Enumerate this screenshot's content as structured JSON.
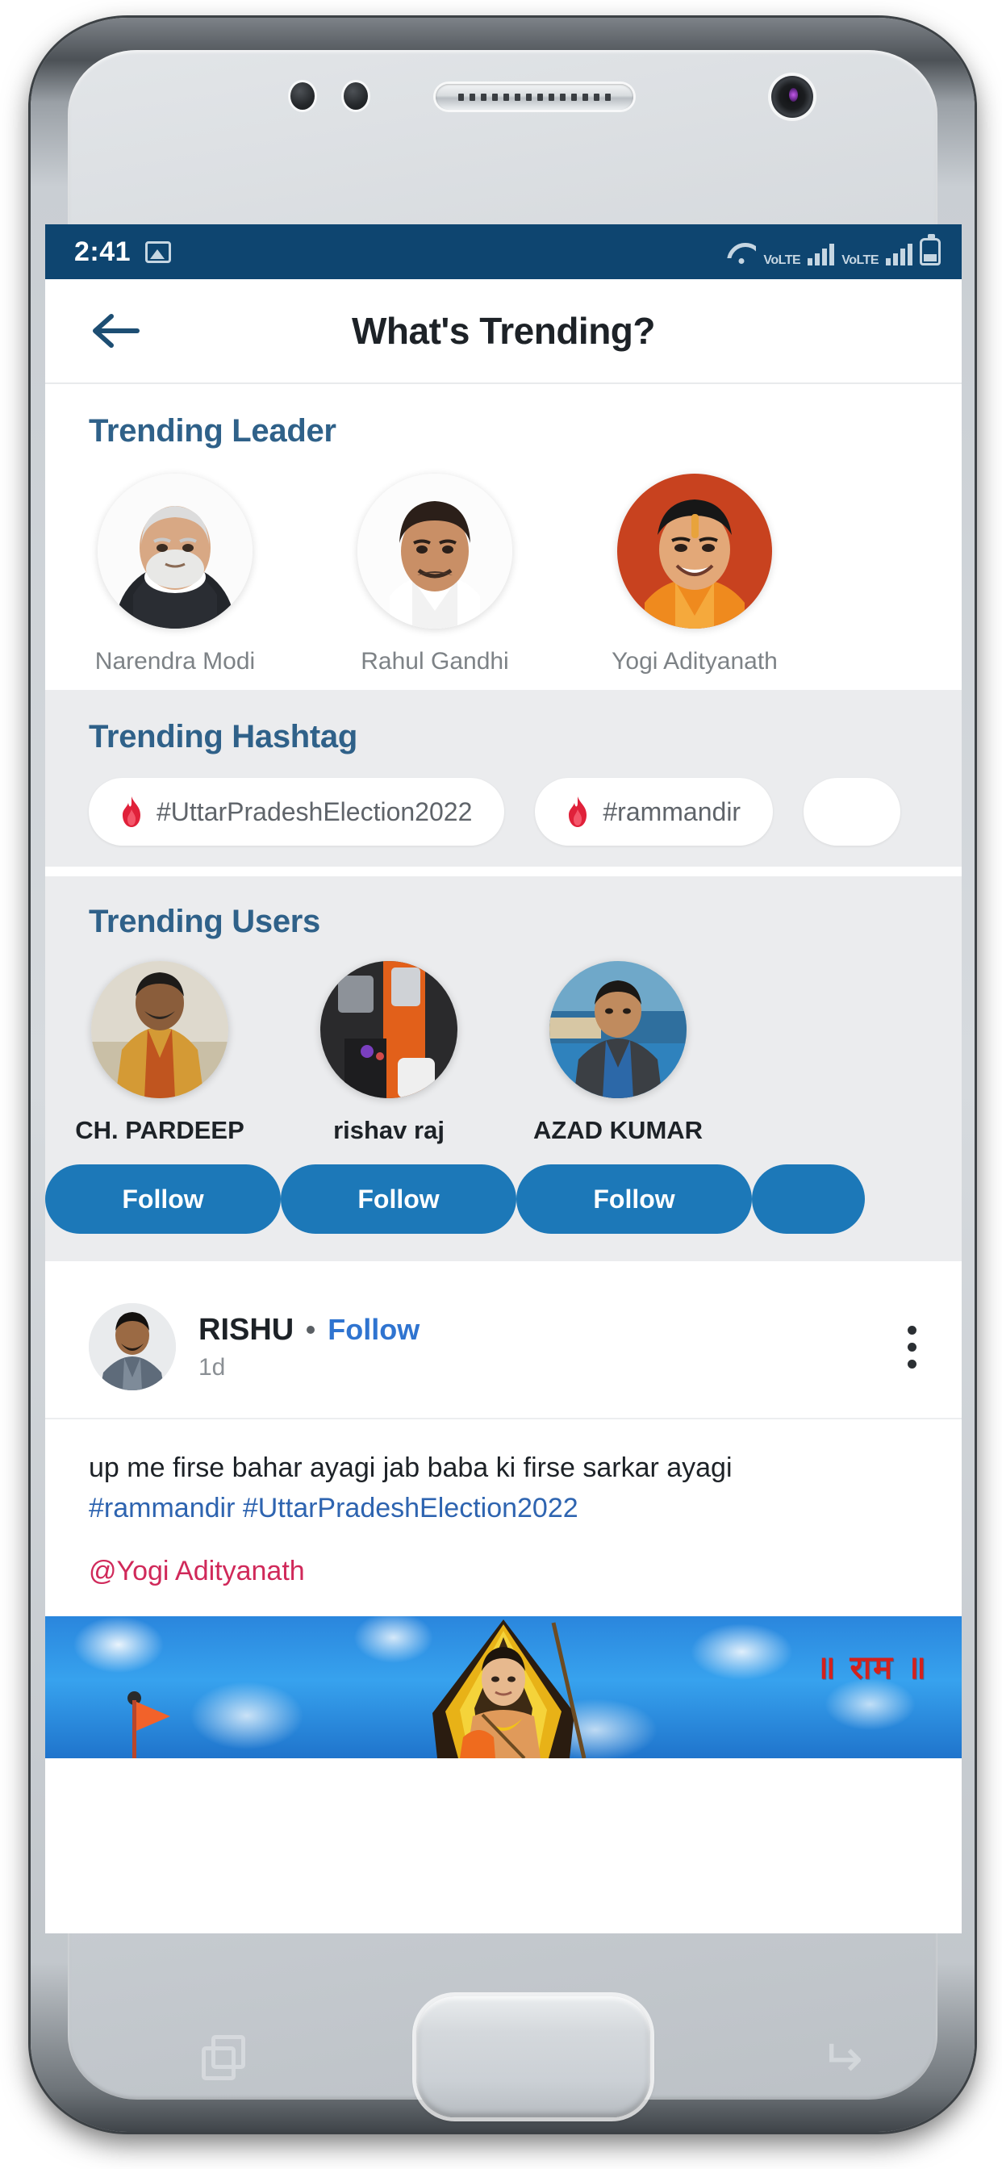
{
  "status_bar": {
    "time": "2:41",
    "image_icon": "image-icon",
    "wifi_icon": "wifi-icon",
    "network_labels": [
      "VoLTE",
      "VoLTE"
    ],
    "battery_icon": "battery-icon"
  },
  "header": {
    "back_icon": "back-arrow-icon",
    "title": "What's Trending?"
  },
  "trending_leader": {
    "title": "Trending Leader",
    "items": [
      {
        "name": "Narendra Modi"
      },
      {
        "name": "Rahul Gandhi"
      },
      {
        "name": "Yogi Adityanath"
      }
    ]
  },
  "trending_hashtag": {
    "title": "Trending Hashtag",
    "flame_icon": "flame-icon",
    "items": [
      {
        "label": "#UttarPradeshElection2022"
      },
      {
        "label": "#rammandir"
      },
      {
        "label": ""
      }
    ]
  },
  "trending_users": {
    "title": "Trending Users",
    "items": [
      {
        "name": "CH. PARDEEP",
        "follow_label": "Follow"
      },
      {
        "name": "rishav raj",
        "follow_label": "Follow"
      },
      {
        "name": "AZAD KUMAR",
        "follow_label": "Follow"
      },
      {
        "name": "",
        "follow_label": ""
      }
    ]
  },
  "post": {
    "author": "RISHU",
    "separator": "•",
    "follow_label": "Follow",
    "time_ago": "1d",
    "menu_icon": "kebab-menu-icon",
    "text": "up me firse bahar ayagi jab baba ki firse sarkar ayagi",
    "hashtags": "#rammandir #UttarPradeshElection2022",
    "mention": "@Yogi Adityanath",
    "image_caption": "॥ राम ॥"
  },
  "device": {
    "recents_icon": "recents-icon",
    "home_button": "home-button",
    "back_nav_icon": "back-nav-icon",
    "earpiece": "earpiece-speaker",
    "front_camera": "front-camera-icon"
  },
  "colors": {
    "status_bar_bg": "#0e4570",
    "section_heading": "#2f6189",
    "follow_button": "#1c78b8",
    "hashtag_link": "#2e64b0",
    "mention": "#d0295a",
    "flame": "#e0213a",
    "section_grey": "#ebecee"
  }
}
